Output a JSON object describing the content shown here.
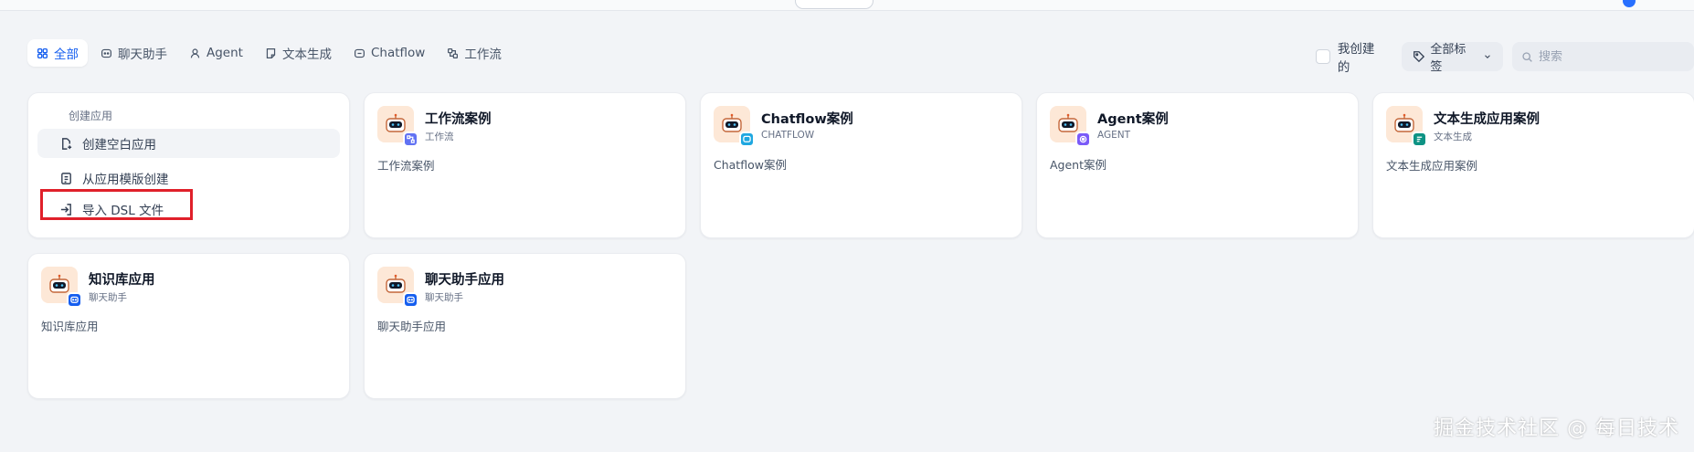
{
  "tabs": [
    {
      "label": "全部",
      "icon": "grid-icon",
      "active": true
    },
    {
      "label": "聊天助手",
      "icon": "chat-bubble-icon"
    },
    {
      "label": "Agent",
      "icon": "agent-icon"
    },
    {
      "label": "文本生成",
      "icon": "document-icon"
    },
    {
      "label": "Chatflow",
      "icon": "chatflow-icon"
    },
    {
      "label": "工作流",
      "icon": "workflow-icon"
    }
  ],
  "toolbar": {
    "created_by_me_label": "我创建的",
    "tags_label": "全部标签",
    "search_placeholder": "搜索"
  },
  "create": {
    "title": "创建应用",
    "items": [
      {
        "label": "创建空白应用",
        "icon": "new-file-icon"
      },
      {
        "label": "从应用模版创建",
        "icon": "template-icon"
      },
      {
        "label": "导入 DSL 文件",
        "icon": "import-icon"
      }
    ]
  },
  "apps": [
    {
      "name": "工作流案例",
      "type": "工作流",
      "desc": "工作流案例",
      "badge_icon": "workflow-badge-icon",
      "badge_color": "#6172f3"
    },
    {
      "name": "Chatflow案例",
      "type": "CHATFLOW",
      "desc": "Chatflow案例",
      "badge_icon": "chatflow-badge-icon",
      "badge_color": "#1fa7e0"
    },
    {
      "name": "Agent案例",
      "type": "AGENT",
      "desc": "Agent案例",
      "badge_icon": "agent-badge-icon",
      "badge_color": "#7a5af8"
    },
    {
      "name": "文本生成应用案例",
      "type": "文本生成",
      "desc": "文本生成应用案例",
      "badge_icon": "text-gen-badge-icon",
      "badge_color": "#0e9384"
    },
    {
      "name": "知识库应用",
      "type": "聊天助手",
      "desc": "知识库应用",
      "badge_icon": "chat-badge-icon",
      "badge_color": "#155eef"
    },
    {
      "name": "聊天助手应用",
      "type": "聊天助手",
      "desc": "聊天助手应用",
      "badge_icon": "chat-badge-icon",
      "badge_color": "#155eef"
    }
  ],
  "watermark": "掘金技术社区 @ 每日技术"
}
